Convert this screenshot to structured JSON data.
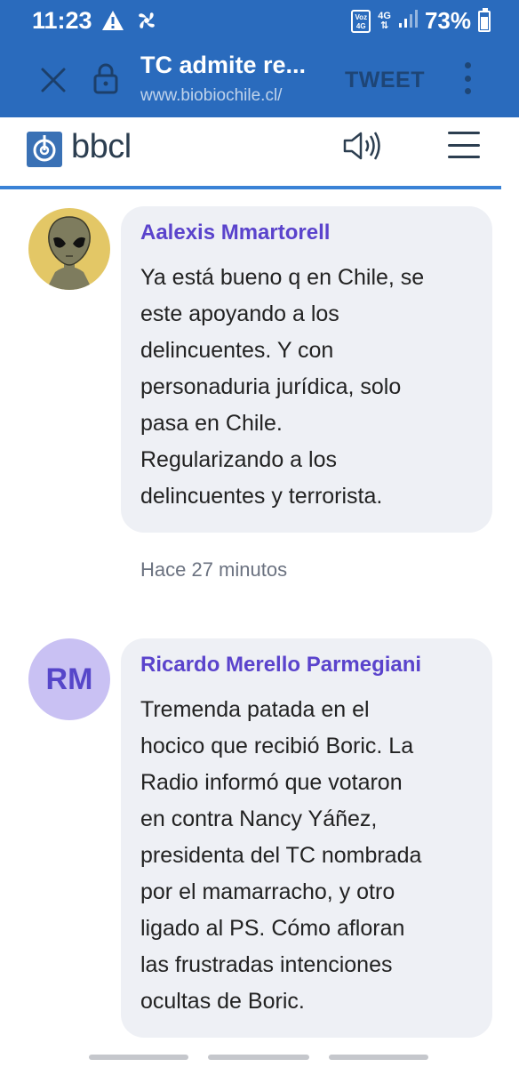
{
  "status_bar": {
    "time": "11:23",
    "net_badge_top": "Voz",
    "net_badge_bottom": "4G",
    "network_type": "4G",
    "battery_percent": "73%",
    "icons": [
      "warning-icon",
      "fan-icon",
      "voz4g-icon",
      "signal-icon",
      "battery-icon"
    ]
  },
  "tab_bar": {
    "title": "TC admite re...",
    "url": "www.biobiochile.cl/",
    "tweet_label": "TWEET",
    "icons": [
      "close-icon",
      "lock-icon",
      "more-vert-icon"
    ],
    "color": "#2a6bbd"
  },
  "site_header": {
    "logo_text": "bbcl",
    "icons": [
      "bbcl-logo-icon",
      "speaker-icon",
      "hamburger-menu-icon"
    ],
    "accent": "#3a82d6"
  },
  "comments": [
    {
      "author": "Aalexis Mmartorell",
      "lines": [
        "Ya está bueno q en Chile, se",
        "este apoyando a los",
        "delincuentes. Y con",
        "personaduria jurídica, solo",
        "pasa en Chile.",
        "Regularizando a los",
        "delincuentes y terrorista."
      ],
      "time": "Hace 27 minutos",
      "avatar_type": "alien-avatar-icon"
    },
    {
      "author": "Ricardo Merello Parmegiani",
      "initials": "RM",
      "lines": [
        "Tremenda patada en el",
        "hocico que recibió Boric. La",
        "Radio informó que votaron",
        "en contra Nancy Yáñez,",
        "presidenta del TC nombrada",
        "por el mamarracho, y otro",
        "ligado al PS. Cómo afloran",
        "las frustradas intenciones",
        "ocultas de Boric."
      ]
    }
  ],
  "colors": {
    "author": "#5a43cc",
    "bubble": "#eef0f5",
    "rm_avatar_bg": "#c9c1f3"
  }
}
